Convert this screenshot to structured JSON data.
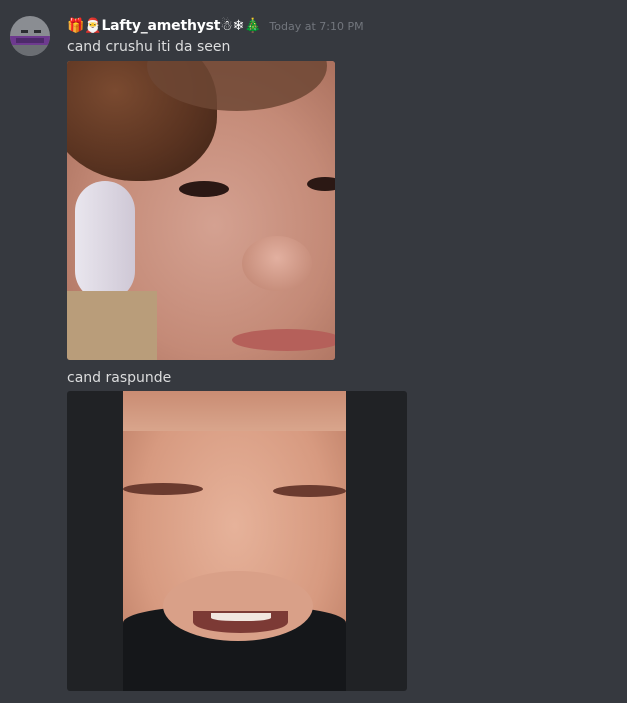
{
  "message": {
    "author": {
      "name": "🎁🎅Lafty_amethyst☃❄🎄",
      "avatar_icon": "pixel-avatar-icon"
    },
    "timestamp": "Today at 7:10 PM",
    "lines": [
      {
        "text": "cand crushu iti da seen"
      },
      {
        "text": "cand raspunde"
      }
    ],
    "attachments": [
      {
        "type": "image",
        "description_icon": "photo-icon"
      },
      {
        "type": "image",
        "description_icon": "photo-icon"
      }
    ]
  },
  "colors": {
    "background": "#36393f",
    "username": "#ffffff",
    "timestamp": "#72767d",
    "text": "#dcddde",
    "letterbox": "#202225"
  }
}
